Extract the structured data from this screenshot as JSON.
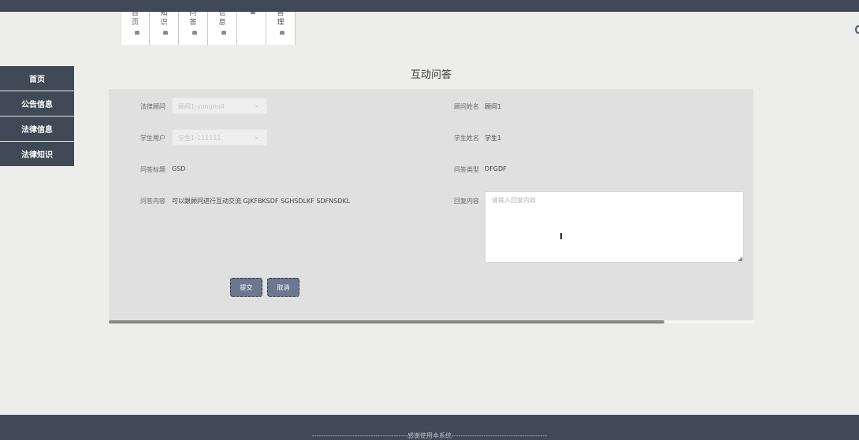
{
  "top_nav": [
    {
      "c1": "首",
      "c2": "页",
      "dot_high": false
    },
    {
      "c1": "知",
      "c2": "识",
      "dot_high": false
    },
    {
      "c1": "问",
      "c2": "答",
      "dot_high": false
    },
    {
      "c1": "信",
      "c2": "息",
      "dot_high": false
    },
    {
      "c1": "",
      "c2": "",
      "dot_high": true
    },
    {
      "c1": "管",
      "c2": "理",
      "dot_high": false
    }
  ],
  "sidebar": {
    "items": [
      {
        "label": "首页"
      },
      {
        "label": "公告信息"
      },
      {
        "label": "法律信息"
      },
      {
        "label": "法律知识"
      }
    ]
  },
  "page": {
    "title": "互动问答"
  },
  "form": {
    "consultant": {
      "label": "法律顾问",
      "value": "顾问1-yonghu4"
    },
    "consultant_name": {
      "label": "顾问姓名",
      "value": "顾问1"
    },
    "student_user": {
      "label": "学生用户",
      "value": "学生1-111111"
    },
    "student_name": {
      "label": "学生姓名",
      "value": "学生1"
    },
    "question_title": {
      "label": "问答标题",
      "value": "GSD"
    },
    "question_type": {
      "label": "问答类型",
      "value": "DFGDF"
    },
    "question_content": {
      "label": "问答内容",
      "value": "可以跟顾问进行互动交流 GJKFBKSDF SGHSDLKF SDFNSDKL"
    },
    "reply": {
      "label": "回复内容",
      "placeholder": "请输入回复内容"
    }
  },
  "buttons": {
    "submit": "提交",
    "cancel": "取消"
  },
  "footer": {
    "text": "------------------------------------------感谢使用本系统------------------------------------------"
  },
  "scrollbar": {
    "position_fraction": 0.86
  },
  "colors": {
    "nav_dark": "#3f4a56",
    "button": "#6d7790",
    "panel": "#e0e0e0",
    "background": "#ededeb"
  },
  "icons": {
    "nav_dot": "bullet-icon",
    "select_arrow": "chevron-down-icon",
    "text_cursor": "i-beam-cursor-icon",
    "resize": "resize-grip-icon"
  }
}
